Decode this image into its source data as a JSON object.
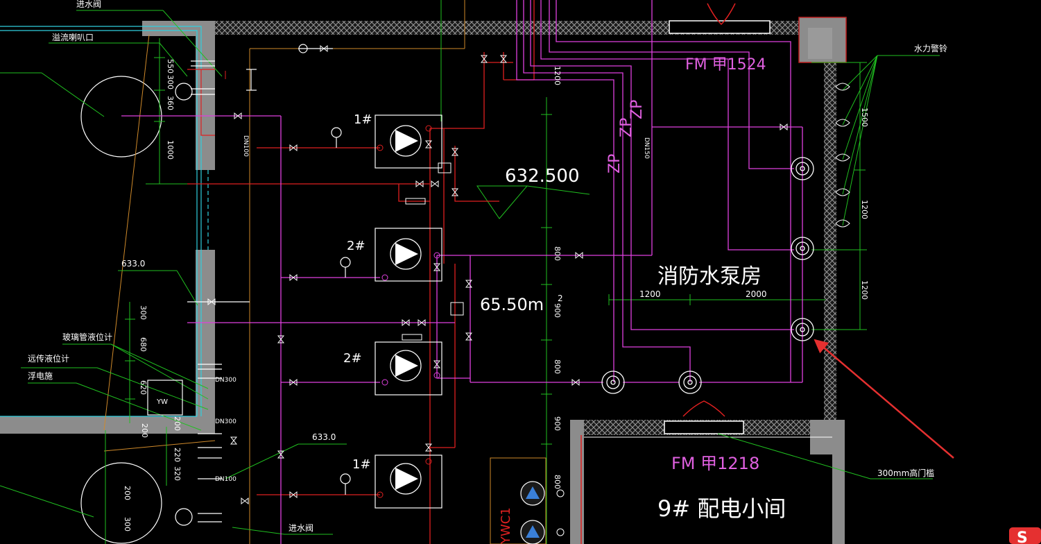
{
  "room": {
    "name": "消防水泵房",
    "area": "65.50m",
    "area_sup": "2",
    "door_top": "FM 甲1524",
    "door_bottom": "FM 甲1218",
    "switch_room": "9# 配电小间",
    "level_mark": "632.500"
  },
  "pumps": [
    "1#",
    "2#",
    "2#",
    "1#"
  ],
  "pipe_labels": [
    "ZP",
    "ZP",
    "ZP",
    "YWC1"
  ],
  "callouts": {
    "inlet_valve_top": "进水阀",
    "overflow": "溢流喇叭口",
    "water_alarm": "水力警铃",
    "glass_level": "玻璃管液位计",
    "remote_level": "远传液位计",
    "float": "浮电施",
    "inlet_valve_bottom": "进水阀",
    "threshold": "300mm高门槛",
    "elev_a": "633.0",
    "elev_b": "633.0"
  },
  "dims": {
    "left": [
      "550",
      "300",
      "360",
      "1000",
      "300",
      "680",
      "620",
      "200",
      "200",
      "220",
      "320",
      "200",
      "300"
    ],
    "mid": [
      "1200",
      "800",
      "900",
      "800",
      "900",
      "800"
    ],
    "right": [
      "1500",
      "1200",
      "1200"
    ],
    "bottom": [
      "1200",
      "2000"
    ],
    "dn": [
      "DN100",
      "DN150",
      "DN300",
      "DN300",
      "DN100"
    ]
  },
  "small_tags": [
    "YW"
  ],
  "colors": {
    "background": "#000000",
    "pipe_magenta": "#e040e0",
    "pipe_red": "#e02020",
    "leader_green": "#20c020",
    "wall_gray": "#8c8c8c",
    "cyan": "#30d0e0",
    "pump_blue": "#3a7fd8",
    "arrow_red": "#e53030"
  }
}
